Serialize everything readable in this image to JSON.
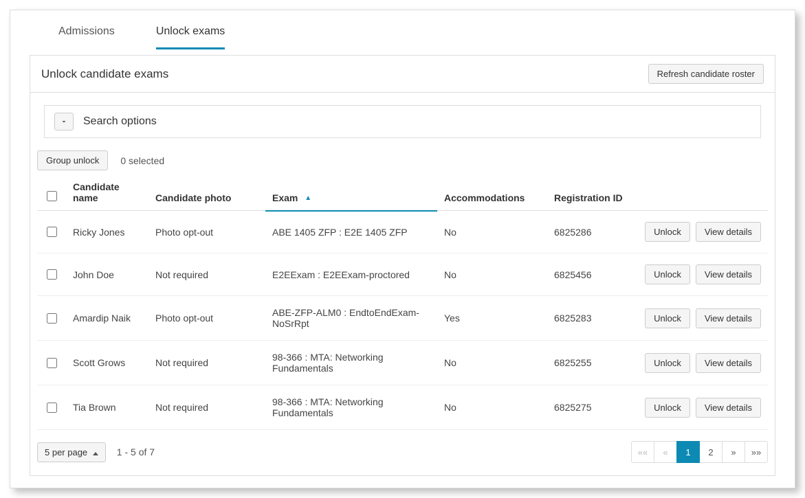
{
  "tabs": {
    "admissions": "Admissions",
    "unlock": "Unlock exams"
  },
  "card": {
    "title": "Unlock candidate exams",
    "refresh_label": "Refresh candidate roster"
  },
  "search": {
    "label": "Search options"
  },
  "actions": {
    "group_unlock": "Group unlock",
    "selected_text": "0 selected"
  },
  "table": {
    "headers": {
      "name": "Candidate name",
      "photo": "Candidate photo",
      "exam": "Exam",
      "accommodations": "Accommodations",
      "registration": "Registration ID"
    },
    "row_buttons": {
      "unlock": "Unlock",
      "view": "View details"
    },
    "rows": [
      {
        "name": "Ricky Jones",
        "photo": "Photo opt-out",
        "exam": "ABE 1405 ZFP : E2E 1405 ZFP",
        "accommodations": "No",
        "registration": "6825286"
      },
      {
        "name": "John Doe",
        "photo": "Not required",
        "exam": "E2EExam : E2EExam-proctored",
        "accommodations": "No",
        "registration": "6825456"
      },
      {
        "name": "Amardip Naik",
        "photo": "Photo opt-out",
        "exam": "ABE-ZFP-ALM0 : EndtoEndExam-NoSrRpt",
        "accommodations": "Yes",
        "registration": "6825283"
      },
      {
        "name": "Scott Grows",
        "photo": "Not required",
        "exam": "98-366 : MTA: Networking Fundamentals",
        "accommodations": "No",
        "registration": "6825255"
      },
      {
        "name": "Tia Brown",
        "photo": "Not required",
        "exam": "98-366 : MTA: Networking Fundamentals",
        "accommodations": "No",
        "registration": "6825275"
      }
    ]
  },
  "footer": {
    "per_page_label": "5 per page",
    "range_text": "1 - 5 of 7",
    "pages": {
      "first": "««",
      "prev": "«",
      "p1": "1",
      "p2": "2",
      "next": "»",
      "last": "»»"
    }
  }
}
